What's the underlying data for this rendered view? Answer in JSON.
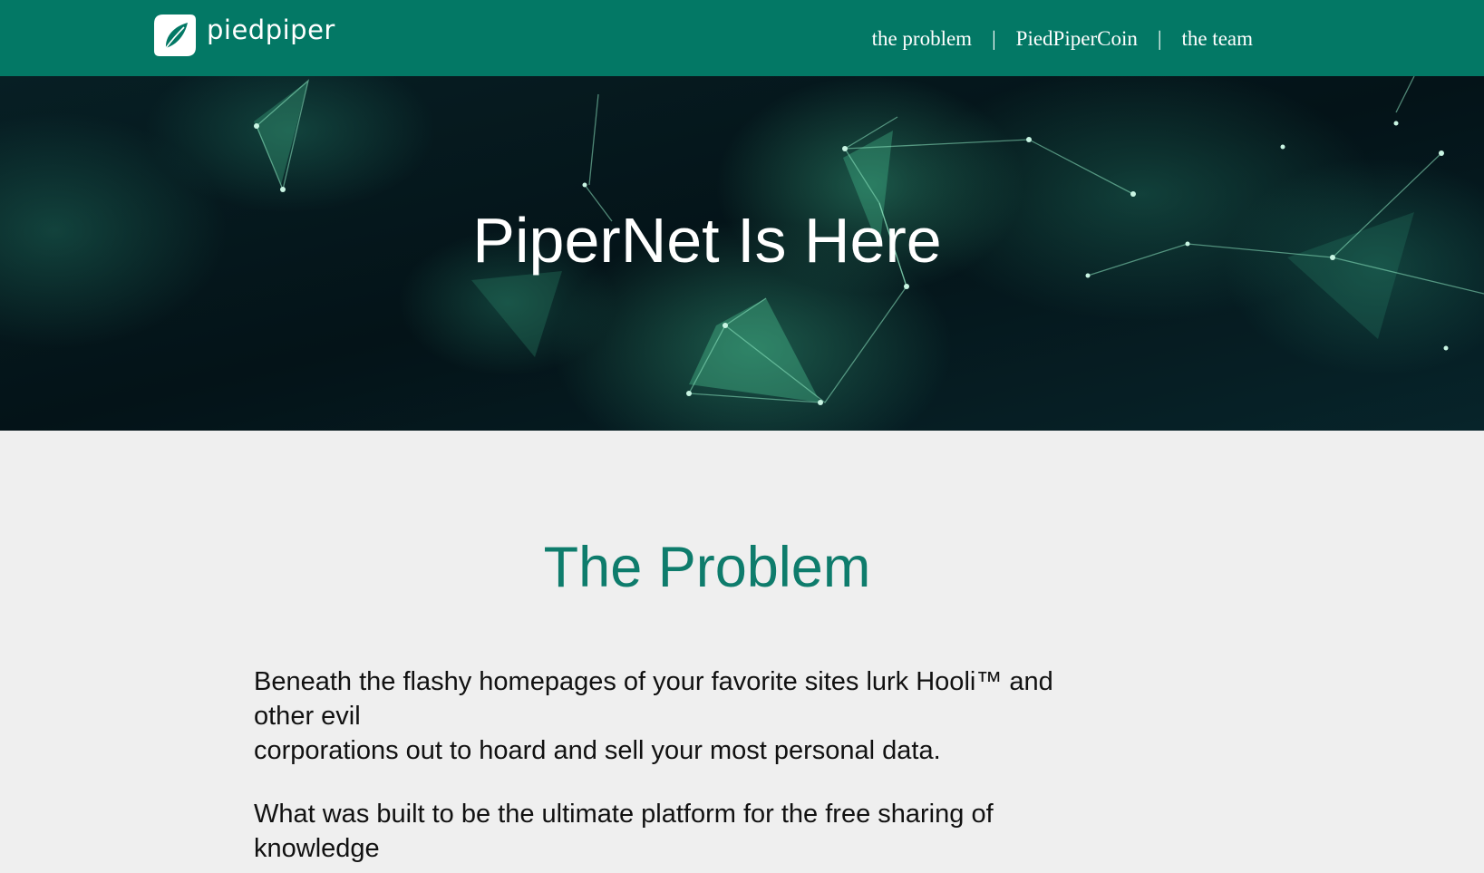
{
  "header": {
    "brand_name": "piedpiper",
    "nav": [
      {
        "label": "the problem"
      },
      {
        "label": "PiedPiperCoin"
      },
      {
        "label": "the team"
      }
    ],
    "separator": "|"
  },
  "hero": {
    "title": "PiperNet Is Here"
  },
  "problem": {
    "heading": "The Problem",
    "paragraphs": [
      {
        "lines": [
          "Beneath the flashy homepages of your favorite sites lurk Hooli™ and",
          "other evil",
          "corporations out to hoard and sell your most personal data."
        ]
      },
      {
        "lines": [
          "What was built to be the ultimate platform for the free sharing of",
          "knowledge"
        ]
      }
    ]
  },
  "colors": {
    "brand_green": "#037865",
    "heading_green": "#0e7c6c",
    "page_background": "#efefef"
  }
}
